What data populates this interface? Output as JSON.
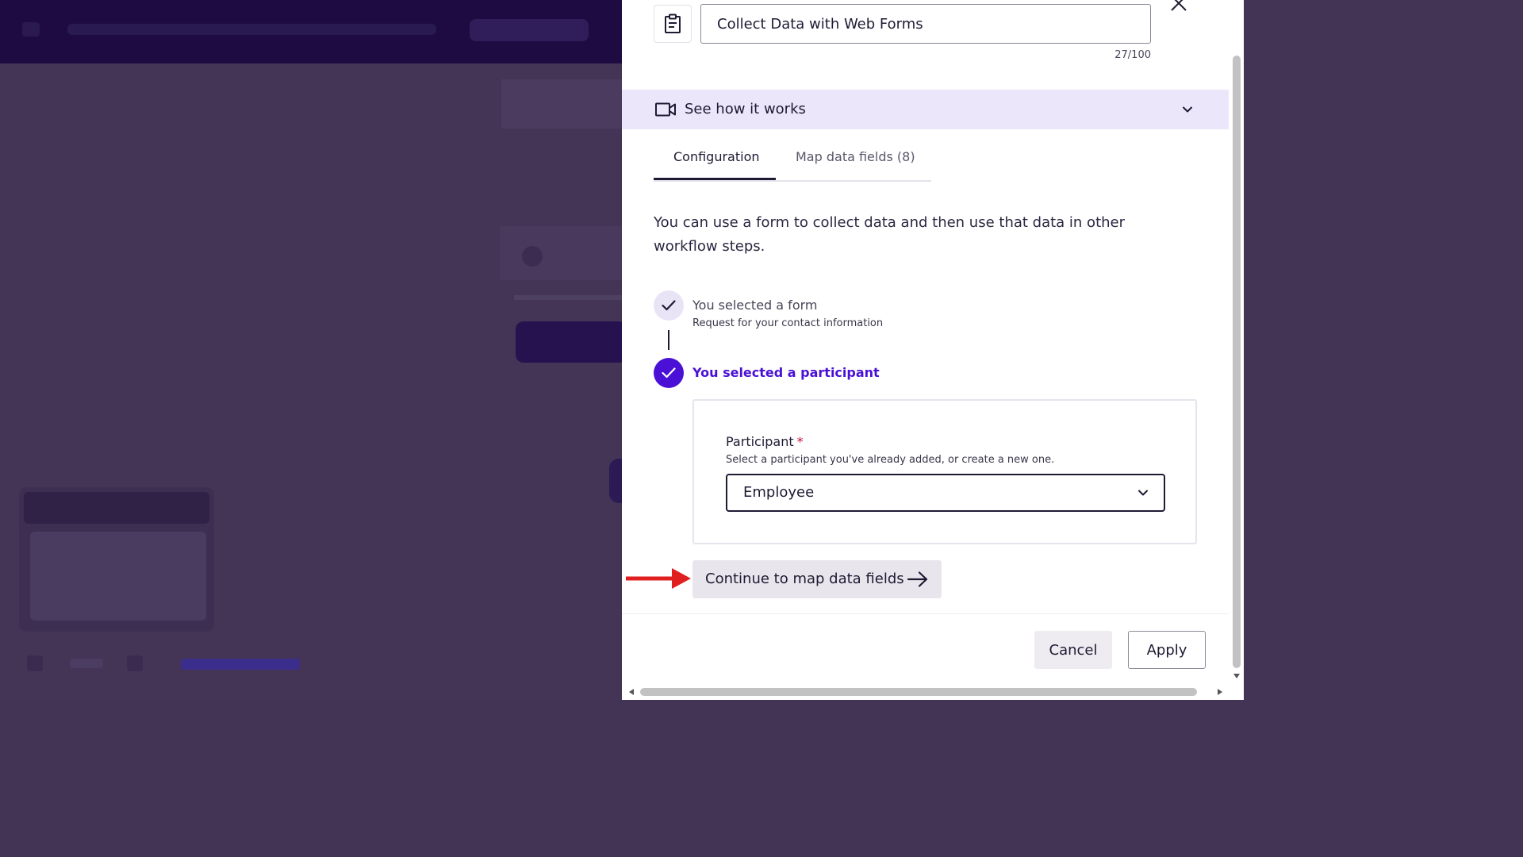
{
  "workflow_step": {
    "name_value": "Collect Data with Web Forms",
    "char_count": "27/100"
  },
  "how_it_works": {
    "label": "See how it works"
  },
  "tabs": [
    {
      "label": "Configuration",
      "active": true
    },
    {
      "label": "Map data fields (8)",
      "active": false
    }
  ],
  "description": "You can use a form to collect data and then use that data in other workflow steps.",
  "steps": [
    {
      "title": "You selected a form",
      "subtitle": "Request for your contact information",
      "state": "complete"
    },
    {
      "title": "You selected a participant",
      "state": "current"
    }
  ],
  "participant": {
    "label": "Participant",
    "required_marker": "*",
    "hint": "Select a participant you've already added, or create a new one.",
    "selected": "Employee"
  },
  "continue_button": {
    "label": "Continue to map data fields"
  },
  "footer": {
    "cancel_label": "Cancel",
    "apply_label": "Apply"
  },
  "icons": {
    "clipboard": "clipboard-icon",
    "close": "close-icon",
    "video": "video-camera-icon",
    "chevron": "chevron-down-icon",
    "check": "check-icon",
    "arrow": "arrow-right-icon",
    "annotation": "red-arrow-annotation"
  },
  "colors": {
    "accent": "#4a10d6",
    "highlight_bar": "#ece6fb",
    "overlay": "#443557",
    "annotation_red": "#e02020"
  }
}
